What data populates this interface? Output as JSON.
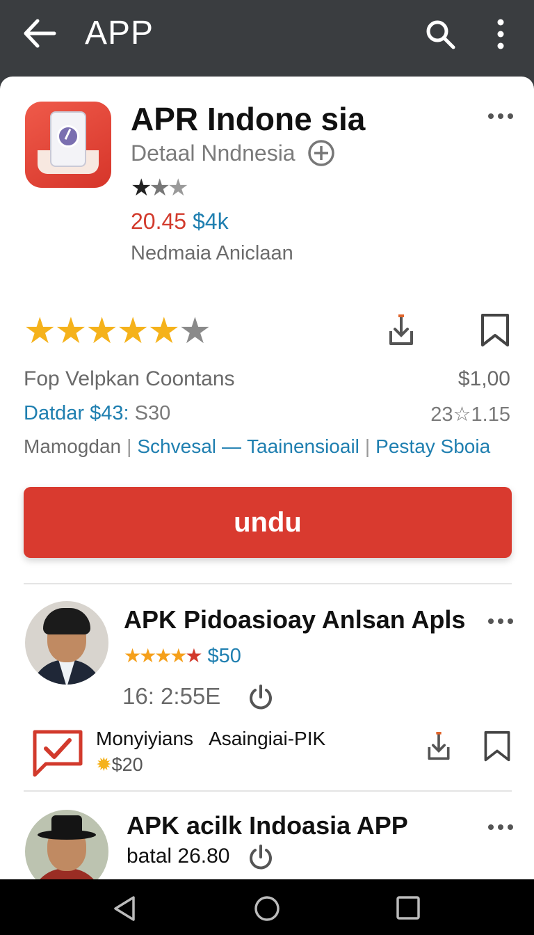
{
  "topbar": {
    "title": "APP",
    "back_icon": "arrow-left-icon",
    "search_icon": "search-icon",
    "menu_icon": "more-vertical-icon"
  },
  "app": {
    "title": "APR Indone sia",
    "subtitle": "Detaal Nndnesia",
    "mini_rating_stars": 3,
    "price_red": "20.45",
    "price_teal": "$4k",
    "developer": "Nedmaia Aniclaan"
  },
  "rating": {
    "filled_stars": 5,
    "total_stars": 6
  },
  "stats": {
    "row1_left": "Fop Velpkan Coontans",
    "row1_right": "$1,00",
    "row2_left_blue": "Datdar $43:",
    "row2_left_grey": "S30",
    "row2_right": "23☆1.15"
  },
  "links": [
    "Mamogdan",
    "Schvesal",
    "Taainensioail",
    "Pestay Sboia"
  ],
  "download_button": "undu",
  "items": [
    {
      "title": "APK Pidoasioay Anlsan Apls",
      "rating_stars": 5,
      "price": "$50",
      "time": "16: 2:55E",
      "tag1": "Monyiyians",
      "tag2": "Asaingiai-PIK",
      "sub_price": "$20"
    },
    {
      "title": "APK acilk Indoasia APP",
      "sub": "batal  26.80"
    }
  ],
  "colors": {
    "accent_red": "#d93a2f",
    "link_blue": "#1f7fb0",
    "star_yellow": "#f5b21b",
    "topbar": "#3a3d40"
  },
  "nav": {
    "back_icon": "nav-back-icon",
    "home_icon": "nav-home-icon",
    "recent_icon": "nav-recent-icon"
  }
}
